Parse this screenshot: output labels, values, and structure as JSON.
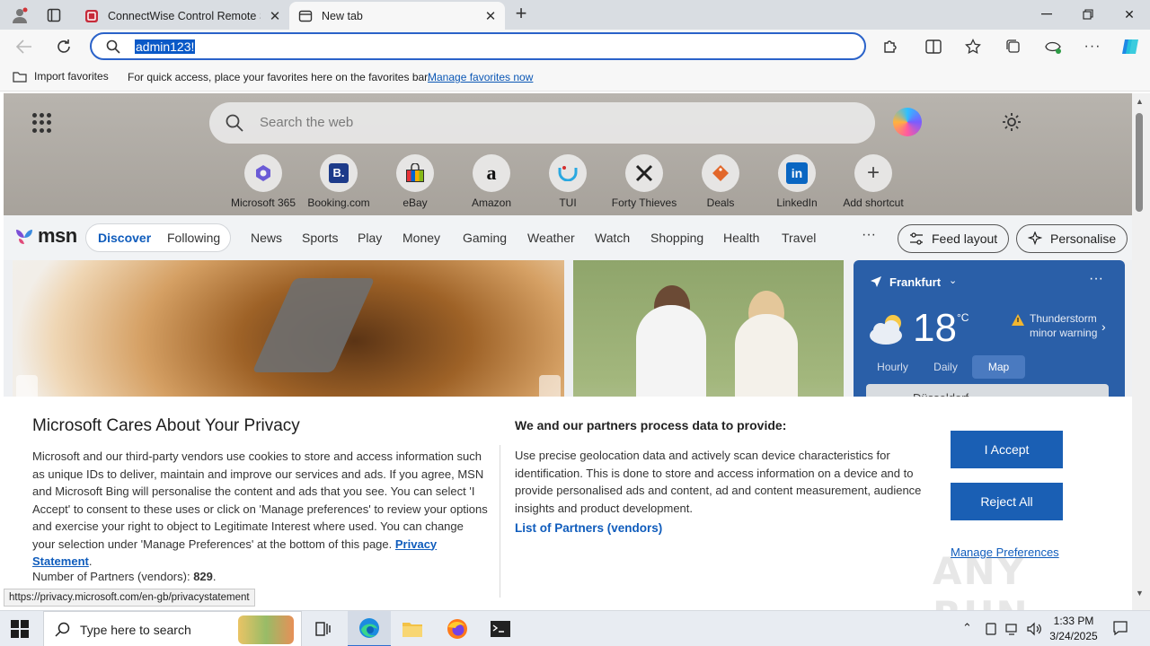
{
  "browser": {
    "tabs": [
      {
        "label": "ConnectWise Control Remote Su",
        "active": false
      },
      {
        "label": "New tab",
        "active": true
      }
    ],
    "address": "admin123!",
    "favorites_bar": {
      "import_label": "Import favorites",
      "message": "For quick access, place your favorites here on the favorites bar.",
      "manage_link": "Manage favorites now"
    },
    "status_url": "https://privacy.microsoft.com/en-gb/privacystatement"
  },
  "newtab": {
    "search_placeholder": "Search the web",
    "shortcuts": [
      {
        "name": "Microsoft 365",
        "icon": "microsoft-365-icon",
        "color": "#6b5bd6"
      },
      {
        "name": "Booking.com",
        "icon": "booking-icon",
        "color": "#1d3b8a"
      },
      {
        "name": "eBay",
        "icon": "ebay-icon",
        "color": "#d93a2b"
      },
      {
        "name": "Amazon",
        "icon": "amazon-icon",
        "color": "#111111"
      },
      {
        "name": "TUI",
        "icon": "tui-icon",
        "color": "#2aa8e0"
      },
      {
        "name": "Forty Thieves",
        "icon": "forty-thieves-icon",
        "color": "#222222"
      },
      {
        "name": "Deals",
        "icon": "deals-icon",
        "color": "#e2672a"
      },
      {
        "name": "LinkedIn",
        "icon": "linkedin-icon",
        "color": "#0a66c2"
      },
      {
        "name": "Add shortcut",
        "icon": "plus-icon",
        "color": "#444444"
      }
    ]
  },
  "msn": {
    "logo": "msn",
    "toggle": {
      "discover": "Discover",
      "following": "Following"
    },
    "nav": [
      "News",
      "Sports",
      "Play",
      "Money",
      "Gaming",
      "Weather",
      "Watch",
      "Shopping",
      "Health",
      "Travel"
    ],
    "more": "···",
    "feed_layout": "Feed layout",
    "personalise": "Personalise"
  },
  "weather": {
    "city": "Frankfurt",
    "temp": "18",
    "unit": "°C",
    "warning_line1": "Thunderstorm",
    "warning_line2": "minor warning",
    "tabs": [
      "Hourly",
      "Daily",
      "Map"
    ],
    "selected_tab": "Map",
    "map_label": "Düsseldorf"
  },
  "privacy": {
    "title": "Microsoft Cares About Your Privacy",
    "body": "Microsoft and our third-party vendors use cookies to store and access information such as unique IDs to deliver, maintain and improve our services and ads. If you agree, MSN and Microsoft Bing will personalise the content and ads that you see. You can select 'I Accept' to consent to these uses or click on 'Manage preferences' to review your options and exercise your right to object to Legitimate Interest where used.  You can change your selection under 'Manage Preferences' at the bottom of this page.",
    "statement_link": "Privacy Statement",
    "partners_label": "Number of Partners (vendors):",
    "partners_count": "829",
    "purposes_title": "We and our partners process data to provide:",
    "purposes_body": "Use precise geolocation data and actively scan device characteristics for identification. This is done to store and access information on a device and to provide personalised ads and content, ad and content measurement, audience insights and product development.",
    "partners_link": "List of Partners (vendors)",
    "accept": "I Accept",
    "reject": "Reject All",
    "manage": "Manage Preferences"
  },
  "watermark": "ANY RUN",
  "taskbar": {
    "search_placeholder": "Type here to search",
    "time": "1:33 PM",
    "date": "3/24/2025"
  }
}
